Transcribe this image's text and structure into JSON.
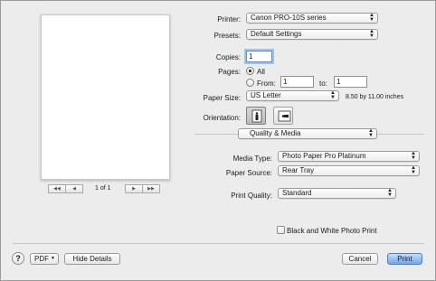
{
  "preview": {
    "page_indicator": "1 of 1",
    "first_icon": "◀◀",
    "prev_icon": "◀",
    "next_icon": "▶",
    "last_icon": "▶▶"
  },
  "printer": {
    "label": "Printer:",
    "value": "Canon PRO-10S series"
  },
  "presets": {
    "label": "Presets:",
    "value": "Default Settings"
  },
  "copies": {
    "label": "Copies:",
    "value": "1"
  },
  "pages": {
    "label": "Pages:",
    "all_label": "All",
    "from_label": "From:",
    "from_value": "1",
    "to_label": "to:",
    "to_value": "1"
  },
  "paper_size": {
    "label": "Paper Size:",
    "value": "US Letter",
    "dimensions": "8.50 by 11.00 inches"
  },
  "orientation": {
    "label": "Orientation:"
  },
  "panel_menu": {
    "value": "Quality & Media"
  },
  "media_type": {
    "label": "Media Type:",
    "value": "Photo Paper Pro Platinum"
  },
  "paper_source": {
    "label": "Paper Source:",
    "value": "Rear Tray"
  },
  "print_quality": {
    "label": "Print Quality:",
    "value": "Standard"
  },
  "bw_photo": {
    "label": "Black and White Photo Print"
  },
  "footer": {
    "help_label": "?",
    "pdf_label": "PDF",
    "hide_details_label": "Hide Details",
    "cancel_label": "Cancel",
    "print_label": "Print"
  },
  "colors": {
    "default_button": "#6da6f2",
    "focus_ring": "#9fc3ef"
  }
}
